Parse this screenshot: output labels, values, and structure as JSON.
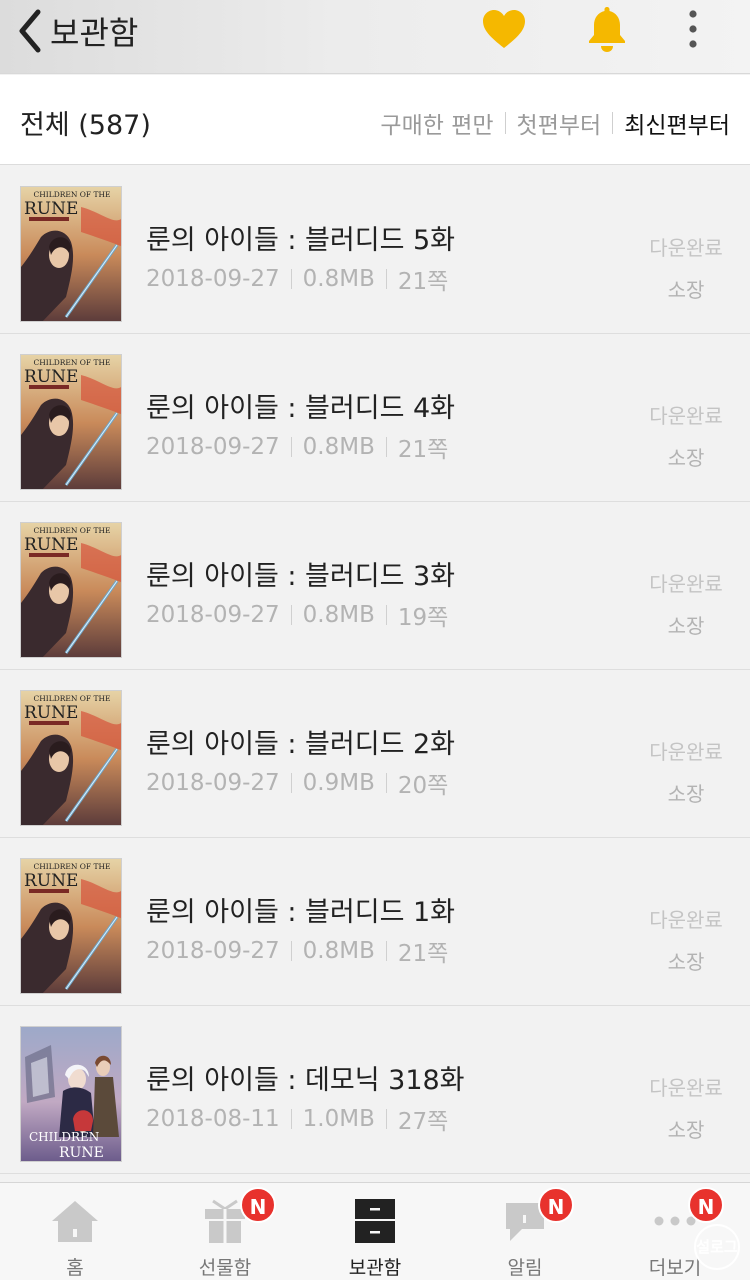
{
  "header": {
    "title": "보관함",
    "icons": [
      "back-chevron-icon",
      "heart-icon",
      "bell-icon",
      "more-vertical-icon"
    ],
    "accent_color": "#f5b800"
  },
  "filter": {
    "total_label": "전체 (587)",
    "sort_options": [
      "구매한 편만",
      "첫편부터",
      "최신편부터"
    ],
    "active_sort": "최신편부터"
  },
  "items": [
    {
      "title": "룬의 아이들 : 블러디드 5화",
      "date": "2018-09-27",
      "size": "0.8MB",
      "pages": "21쪽",
      "status": "다운완료",
      "own": "소장",
      "cover": "bloodied"
    },
    {
      "title": "룬의 아이들 : 블러디드 4화",
      "date": "2018-09-27",
      "size": "0.8MB",
      "pages": "21쪽",
      "status": "다운완료",
      "own": "소장",
      "cover": "bloodied"
    },
    {
      "title": "룬의 아이들 : 블러디드 3화",
      "date": "2018-09-27",
      "size": "0.8MB",
      "pages": "19쪽",
      "status": "다운완료",
      "own": "소장",
      "cover": "bloodied"
    },
    {
      "title": "룬의 아이들 : 블러디드 2화",
      "date": "2018-09-27",
      "size": "0.9MB",
      "pages": "20쪽",
      "status": "다운완료",
      "own": "소장",
      "cover": "bloodied"
    },
    {
      "title": "룬의 아이들 : 블러디드 1화",
      "date": "2018-09-27",
      "size": "0.8MB",
      "pages": "21쪽",
      "status": "다운완료",
      "own": "소장",
      "cover": "bloodied"
    },
    {
      "title": "룬의 아이들 : 데모닉 318화",
      "date": "2018-08-11",
      "size": "1.0MB",
      "pages": "27쪽",
      "status": "다운완료",
      "own": "소장",
      "cover": "demonic"
    }
  ],
  "cover_text": {
    "bloodied_line1": "CHILDREN OF THE",
    "bloodied_line2": "RUNE",
    "demonic_line1": "CHILDREN",
    "demonic_line2": "RUNE"
  },
  "tabs": [
    {
      "label": "홈",
      "icon": "home-icon",
      "badge": ""
    },
    {
      "label": "선물함",
      "icon": "gift-icon",
      "badge": "N"
    },
    {
      "label": "보관함",
      "icon": "locker-icon",
      "badge": "",
      "active": true
    },
    {
      "label": "알림",
      "icon": "speech-bubble-icon",
      "badge": "N"
    },
    {
      "label": "더보기",
      "icon": "more-dots-icon",
      "badge": "N"
    }
  ],
  "watermark": "설로그",
  "colors": {
    "badge": "#e8322d",
    "heart": "#f5b800",
    "bell": "#f5b800"
  }
}
